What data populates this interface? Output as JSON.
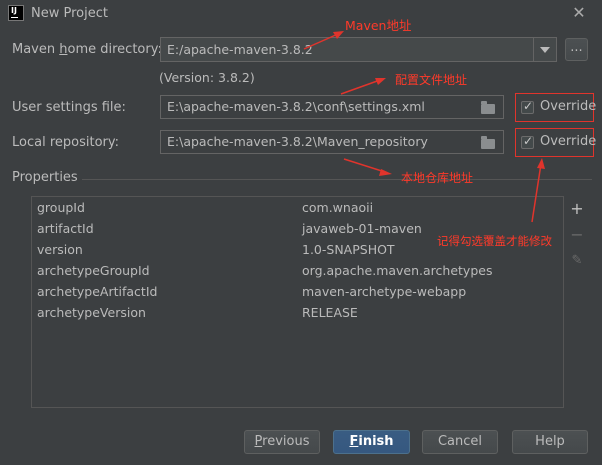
{
  "window": {
    "title": "New Project",
    "app_icon_text": "IJ"
  },
  "maven_home": {
    "label_prefix": "Maven ",
    "label_h": "h",
    "label_rest": "ome directory:",
    "value": "E:/apache-maven-3.8.2",
    "version": "(Version: 3.8.2)",
    "browse_label": "..."
  },
  "user_settings": {
    "label": "User settings file:",
    "value": "E:\\apache-maven-3.8.2\\conf\\settings.xml",
    "override_label": "Override"
  },
  "local_repo": {
    "label": "Local repository:",
    "value": "E:\\apache-maven-3.8.2\\Maven_repository",
    "override_label": "Override"
  },
  "properties": {
    "label": "Properties",
    "rows": [
      {
        "key": "groupId",
        "value": "com.wnaoii"
      },
      {
        "key": "artifactId",
        "value": "javaweb-01-maven"
      },
      {
        "key": "version",
        "value": "1.0-SNAPSHOT"
      },
      {
        "key": "archetypeGroupId",
        "value": "org.apache.maven.archetypes"
      },
      {
        "key": "archetypeArtifactId",
        "value": "maven-archetype-webapp"
      },
      {
        "key": "archetypeVersion",
        "value": "RELEASE"
      }
    ],
    "tools": {
      "add": "+",
      "remove": "−",
      "edit": "✎"
    }
  },
  "annotations": {
    "maven_addr": "Maven地址",
    "settings_addr": "配置文件地址",
    "repo_addr": "本地仓库地址",
    "override_note": "记得勾选覆盖才能修改",
    "color": "#ff3a2a"
  },
  "buttons": {
    "previous_mnemonic": "P",
    "previous_rest": "revious",
    "finish_mnemonic": "F",
    "finish_rest": "inish",
    "cancel": "Cancel",
    "help": "Help"
  }
}
